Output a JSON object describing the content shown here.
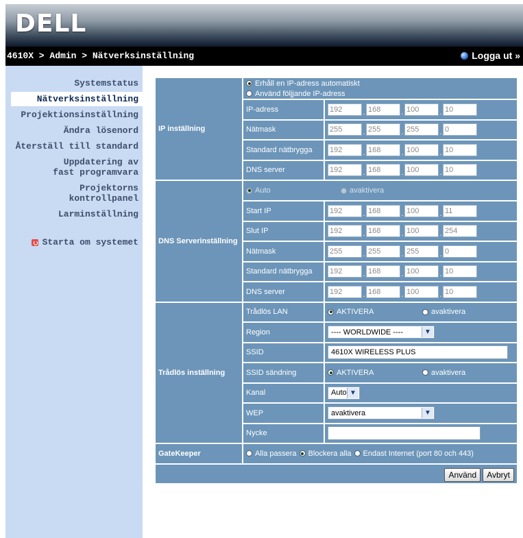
{
  "brand": {
    "logo": "DELL"
  },
  "header": {
    "breadcrumb": "4610X > Admin > Nätverksinställning",
    "logout": "Logga ut »"
  },
  "sidebar": {
    "items": [
      {
        "label": "Systemstatus"
      },
      {
        "label": "Nätverksinställning"
      },
      {
        "label": "Projektionsinställning"
      },
      {
        "label": "Ändra lösenord"
      },
      {
        "label": "Återställ till standard"
      },
      {
        "label": "Uppdatering av fast programvara"
      },
      {
        "label": "Projektorns kontrollpanel"
      },
      {
        "label": "Larminställning"
      }
    ],
    "restart": "Starta om systemet"
  },
  "ip_section": {
    "title": "IP inställning",
    "opt_auto": "Erhåll en IP-adress automatiskt",
    "opt_manual": "Använd följjande IP-adress",
    "rows": [
      {
        "label": "IP-adress",
        "octets": [
          "192",
          "168",
          "100",
          "10"
        ]
      },
      {
        "label": "Nätmask",
        "octets": [
          "255",
          "255",
          "255",
          "0"
        ]
      },
      {
        "label": "Standard nätbrygga",
        "octets": [
          "192",
          "168",
          "100",
          "10"
        ]
      },
      {
        "label": "DNS server",
        "octets": [
          "192",
          "168",
          "100",
          "10"
        ]
      }
    ]
  },
  "dns_section": {
    "title": "DNS Serverinställning",
    "opt_auto": "Auto",
    "opt_disable": "avaktivera",
    "rows": [
      {
        "label": "Start IP",
        "octets": [
          "192",
          "168",
          "100",
          "11"
        ]
      },
      {
        "label": "Slut IP",
        "octets": [
          "192",
          "168",
          "100",
          "254"
        ]
      },
      {
        "label": "Nätmask",
        "octets": [
          "255",
          "255",
          "255",
          "0"
        ]
      },
      {
        "label": "Standard nätbrygga",
        "octets": [
          "192",
          "168",
          "100",
          "10"
        ]
      },
      {
        "label": "DNS server",
        "octets": [
          "192",
          "168",
          "100",
          "10"
        ]
      }
    ]
  },
  "wireless": {
    "title": "Trådlös inställning",
    "lan_label": "Trådlös LAN",
    "lan_on": "AKTIVERA",
    "lan_off": "avaktivera",
    "region_label": "Region",
    "region_value": "---- WORLDWIDE ----",
    "ssid_label": "SSID",
    "ssid_value": "4610X WIRELESS PLUS",
    "broadcast_label": "SSID sändning",
    "broadcast_on": "AKTIVERA",
    "broadcast_off": "avaktivera",
    "channel_label": "Kanal",
    "channel_value": "Auto",
    "wep_label": "WEP",
    "wep_value": "avaktivera",
    "key_label": "Nycke",
    "key_value": ""
  },
  "gatekeeper": {
    "title": "GateKeeper",
    "opt_all": "Alla passera",
    "opt_block": "Blockera alla",
    "opt_internet": "Endast Internet (port 80 och 443)"
  },
  "buttons": {
    "apply": "Använd",
    "cancel": "Avbryt"
  }
}
